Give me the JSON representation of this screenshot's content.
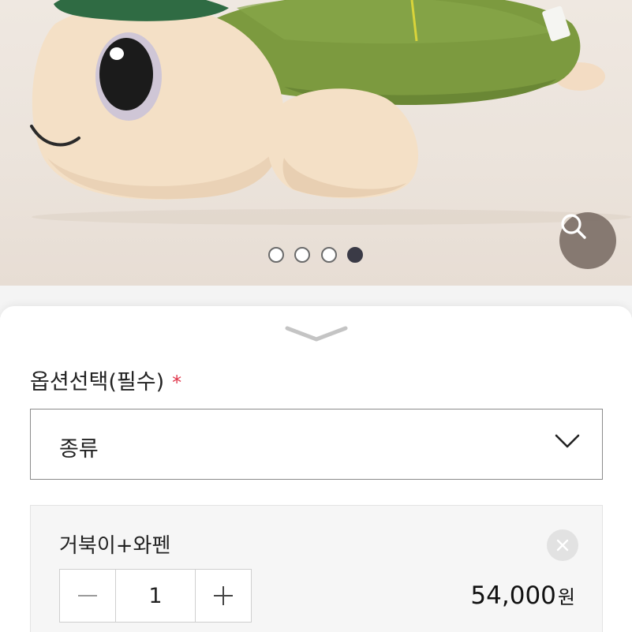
{
  "product_image": {
    "subject": "turtle-plush",
    "carousel": {
      "total": 4,
      "active_index": 3
    },
    "zoom_icon": "search-icon"
  },
  "sheet": {
    "handle_icon": "chevron-down-icon",
    "option_title": "옵션선택(필수)",
    "required_mark": "*",
    "select": {
      "value": "종류",
      "icon": "chevron-down-icon"
    },
    "selected_item": {
      "name": "거북이+와펜",
      "quantity": "1",
      "price": "54,000",
      "price_unit": "원",
      "remove_icon": "close-icon",
      "decrement_icon": "minus-icon",
      "increment_icon": "plus-icon"
    }
  },
  "colors": {
    "accent_required": "#e0354a",
    "dot_active": "#3a3a46",
    "zoom_button": "#7d7068"
  }
}
